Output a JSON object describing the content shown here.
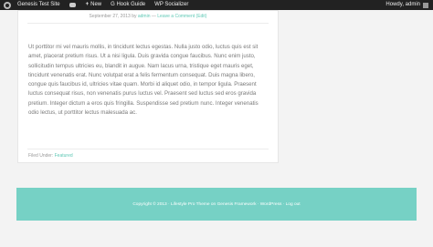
{
  "adminbar": {
    "site_name": "Genesis Test Site",
    "new_label": "New",
    "hook_guide": "G Hook Guide",
    "socializer": "WP Socializer",
    "howdy": "Howdy, admin"
  },
  "post": {
    "date": "September 27, 2013",
    "by": "by",
    "author": "admin",
    "separator": "—",
    "comment_link": "Leave a Comment (Edit)",
    "content": "Ut porttitor mi vel mauris mollis, in tincidunt lectus egestas. Nulla justo odio, luctus quis est sit amet, placerat pretium risus. Ut a nisi ligula. Duis gravida congue faucibus. Nunc enim justo, sollicitudin tempus ultricies eu, blandit in augue. Nam lacus urna, tristique eget mauris eget, tincidunt venenatis erat. Nunc volutpat erat a felis fermentum consequat. Duis magna libero, congue quis faucibus id, ultricies vitae quam. Morbi id aliquet odio, in tempor ligula. Praesent luctus consequat risus, non venenatis purus luctus vel. Praesent sed luctus sed eros gravida pretium. Integer dictum a eros quis fringilla. Suspendisse sed pretium nunc. Integer venenatis odio lectus, ut porttitor lectus malesuada ac.",
    "filed_under_label": "Filed Under:",
    "category": "Featured"
  },
  "footer": {
    "text": "Copyright © 2013 · Lifestyle Pro Theme on Genesis Framework · WordPress · Log out"
  }
}
